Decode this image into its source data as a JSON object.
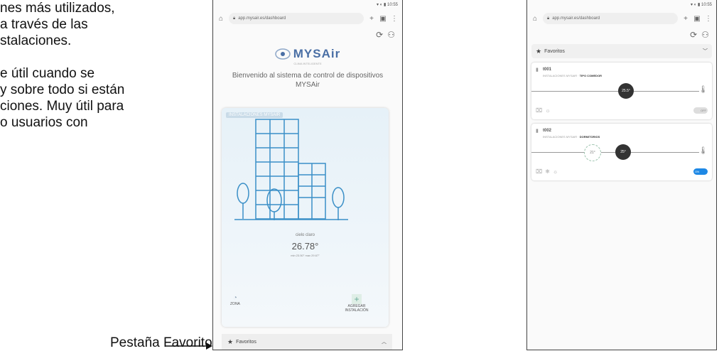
{
  "doc": {
    "lines_a": [
      "nes más utilizados,",
      "a través  de las",
      "stalaciones."
    ],
    "lines_b": [
      "e útil cuando se",
      "y sobre todo si están",
      "ciones. Muy útil para",
      "o usuarios con"
    ],
    "annotation": "Pestaña Favoritos"
  },
  "phone1": {
    "status": "▾ ◐ ▮ 10:55",
    "url": "app.mysair.es/dashboard",
    "brand": "MYSAir",
    "brand_sub": "CLIMA INTELIGENTE",
    "welcome": "Bienvenido al sistema de control de dispositivos MYSAir",
    "card_title": "INSTALACIONES MYSAIR",
    "condition": "cielo claro",
    "temperature": "26.78°",
    "minmax": "min 23.50° max 29.67°",
    "action_zona": "ZONA",
    "action_add": "AGREGAR INSTALACIÓN",
    "fav_label": "Favoritos"
  },
  "phone2": {
    "status": "▾ ◐ ▮ 10:55",
    "url": "app.mysair.es/dashboard",
    "fav_label": "Favoritos",
    "devices": [
      {
        "name": "t001",
        "install": "INSTALACIONES MYSAIR",
        "zone": "TIPO COMEDOR",
        "knob": "25.5°",
        "toggle": "OFF"
      },
      {
        "name": "t002",
        "install": "INSTALACIONES MYSAIR",
        "zone": "DORMITORIOS",
        "knob_a": "21°",
        "knob_b": "25°",
        "toggle": "ON"
      }
    ]
  },
  "colors": {
    "accent": "#1e88e5",
    "brand": "#4a6fa5"
  }
}
